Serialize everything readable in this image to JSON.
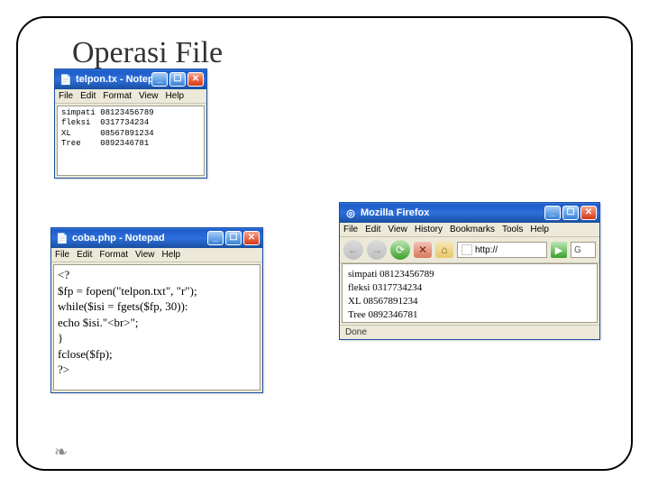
{
  "slide": {
    "title": "Operasi File",
    "bullet": "❧"
  },
  "notepad1": {
    "title": "telpon.tx - Notepad",
    "menu": [
      "File",
      "Edit",
      "Format",
      "View",
      "Help"
    ],
    "body": "simpati 08123456789\nfleksi  0317734234\nXL      08567891234\nTree    0892346781"
  },
  "notepad2": {
    "title": "coba.php - Notepad",
    "menu": [
      "File",
      "Edit",
      "Format",
      "View",
      "Help"
    ],
    "body": "<?\n$fp = fopen(\"telpon.txt\", \"r\");\nwhile($isi = fgets($fp, 30)):\necho $isi.\"<br>\";\n}\nfclose($fp);\n?>"
  },
  "firefox": {
    "title": "Mozilla Firefox",
    "menu": [
      "File",
      "Edit",
      "View",
      "History",
      "Bookmarks",
      "Tools",
      "Help"
    ],
    "address": "http://",
    "search_placeholder": "G",
    "body_lines": [
      "simpati 08123456789",
      "fleksi 0317734234",
      "XL 08567891234",
      "Tree 0892346781"
    ],
    "status": "Done"
  },
  "winbtn_labels": {
    "min": "_",
    "max": "☐",
    "close": "✕"
  },
  "icons": {
    "notepad": "📄",
    "firefox": "◎",
    "back": "←",
    "fwd": "→",
    "reload": "⟳",
    "stop": "✕",
    "home": "⌂",
    "go": "▶"
  }
}
